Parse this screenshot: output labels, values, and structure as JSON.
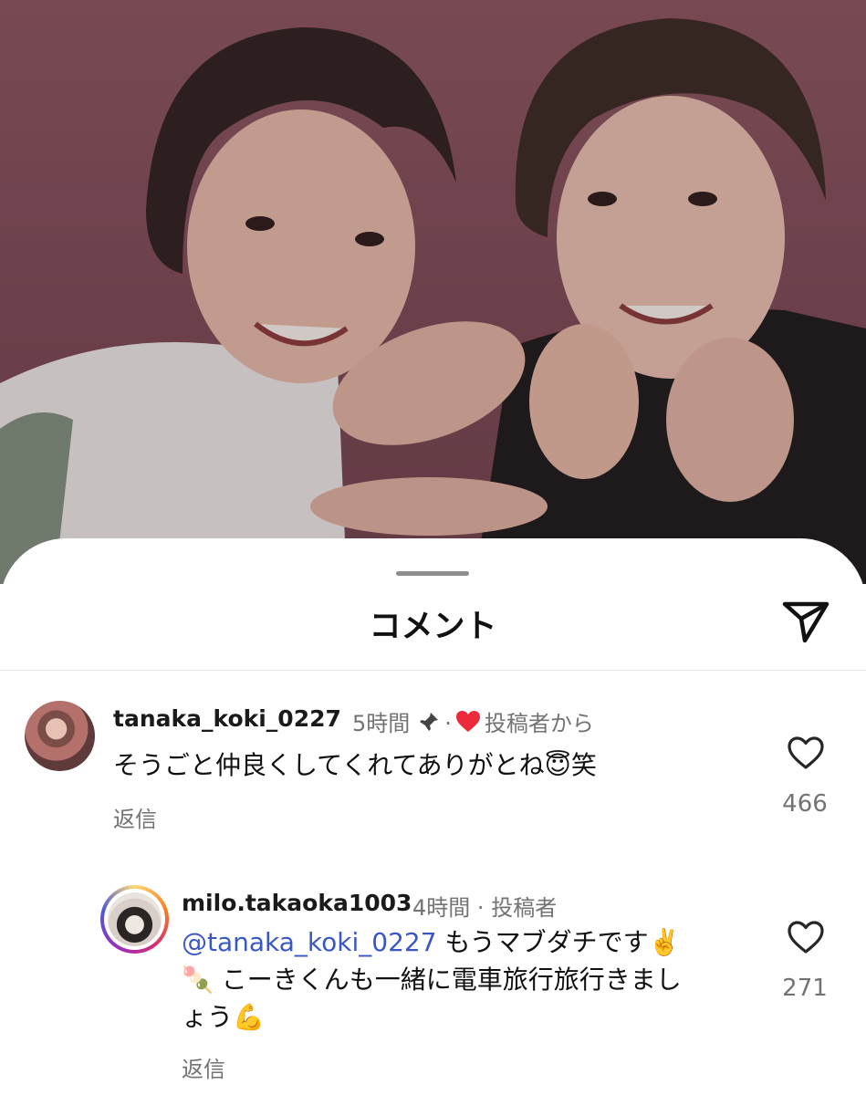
{
  "sheet": {
    "title": "コメント"
  },
  "comments": [
    {
      "username": "tanaka_koki_0227",
      "time": "5時間",
      "dot": "·",
      "liked_by_author_label": "投稿者から",
      "text": "そうごと仲良くしてくれてありがとね😇笑",
      "reply_label": "返信",
      "likes": "466"
    },
    {
      "username": "milo.takaoka1003",
      "time": "4時間",
      "dot": "·",
      "author_label": "投稿者",
      "mention": "@tanaka_koki_0227",
      "text_line1": " もうマブダチです✌️",
      "text_line2": "🍡 こーきくんも一緒に電車旅行旅行きまし",
      "text_line3": "ょう💪",
      "reply_label": "返信",
      "likes": "271"
    }
  ],
  "colors": {
    "accent_mention": "#3b57c4",
    "like_heart_red": "#ed2a3c",
    "muted_text": "#737373"
  },
  "icons": {
    "send": "send-icon",
    "pin": "pin-icon",
    "author_like": "heart-filled-icon",
    "like": "heart-outline-icon"
  }
}
